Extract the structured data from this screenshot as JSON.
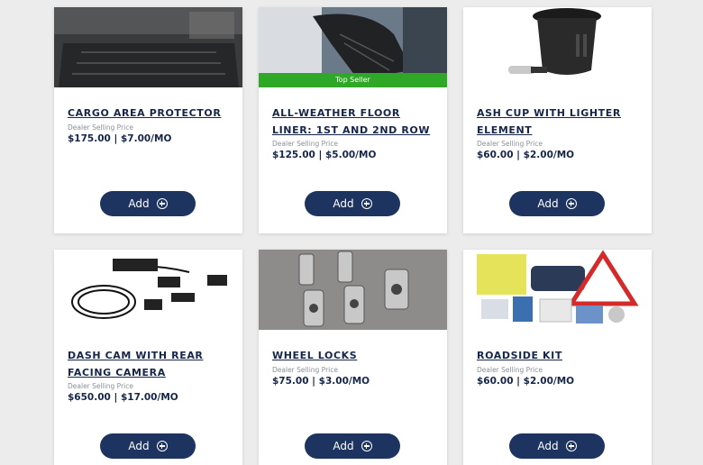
{
  "products": [
    {
      "title": "CARGO AREA PROTECTOR",
      "price_label": "Dealer Selling Price",
      "price": "$175.00 | $7.00/MO",
      "add_label": "Add",
      "image": "cargo-mat-image"
    },
    {
      "title": "ALL-WEATHER FLOOR LINER: 1ST AND 2ND ROW",
      "price_label": "Dealer Selling Price",
      "price": "$125.00 | $5.00/MO",
      "add_label": "Add",
      "badge": "Top Seller",
      "image": "floor-liner-image"
    },
    {
      "title": "ASH CUP WITH LIGHTER ELEMENT",
      "price_label": "Dealer Selling Price",
      "price": "$60.00 | $2.00/MO",
      "add_label": "Add",
      "image": "ash-cup-image"
    },
    {
      "title": "DASH CAM WITH REAR FACING CAMERA",
      "price_label": "Dealer Selling Price",
      "price": "$650.00 | $17.00/MO",
      "add_label": "Add",
      "image": "dash-cam-image"
    },
    {
      "title": "WHEEL LOCKS",
      "price_label": "Dealer Selling Price",
      "price": "$75.00 | $3.00/MO",
      "add_label": "Add",
      "image": "wheel-locks-image"
    },
    {
      "title": "ROADSIDE KIT",
      "price_label": "Dealer Selling Price",
      "price": "$60.00 | $2.00/MO",
      "add_label": "Add",
      "image": "roadside-kit-image"
    }
  ],
  "colors": {
    "brand_navy": "#1d3461",
    "title_navy": "#15264a",
    "badge_green": "#2fa827"
  }
}
